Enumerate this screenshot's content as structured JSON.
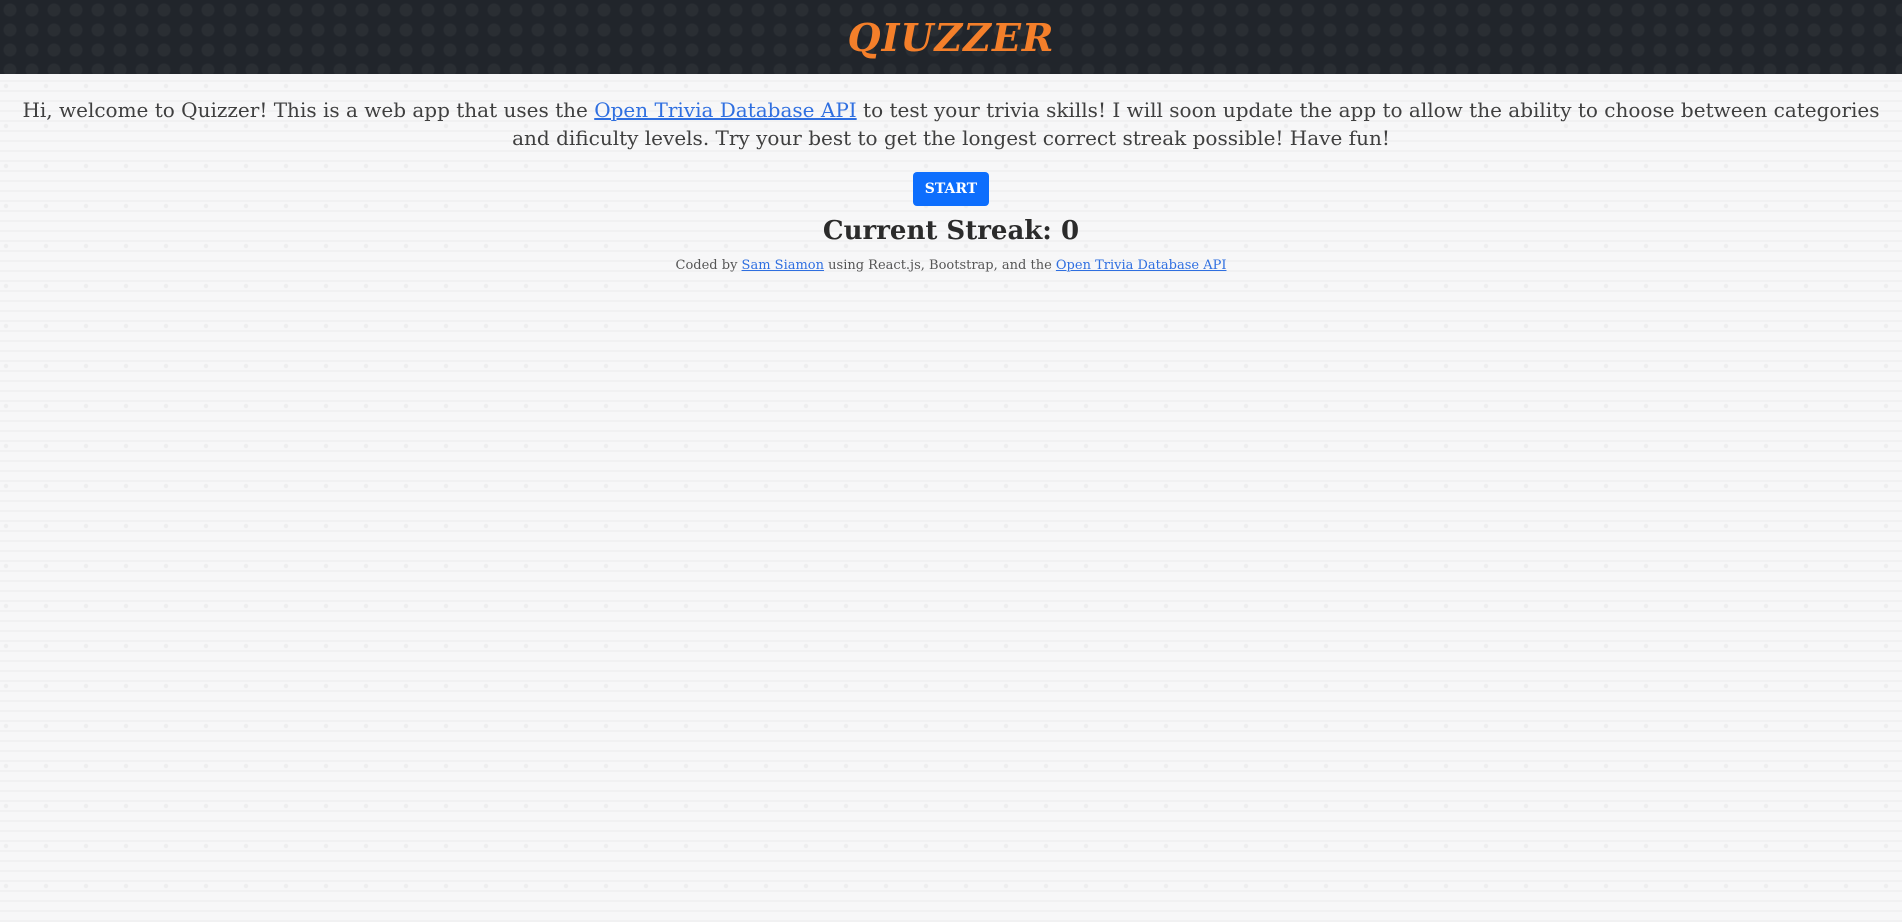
{
  "header": {
    "title": "QIUZZER",
    "title_color": "#f47f2a",
    "background_color": "#21252b"
  },
  "intro": {
    "before_link": "Hi, welcome to Quizzer! This is a web app that uses the ",
    "link_text": "Open Trivia Database API",
    "after_link": " to test your trivia skills! I will soon update the app to allow the ability to choose between categories and dificulty levels. Try your best to get the longest correct streak possible! Have fun!"
  },
  "start_button": {
    "label": "START",
    "color": "#0d6efd"
  },
  "streak": {
    "label": "Current Streak: ",
    "value": "0"
  },
  "credits": {
    "prefix": "Coded by ",
    "author_link": "Sam Siamon",
    "middle": " using React.js, Bootstrap, and the ",
    "api_link": "Open Trivia Database API"
  },
  "link_color": "#2f6fe0"
}
